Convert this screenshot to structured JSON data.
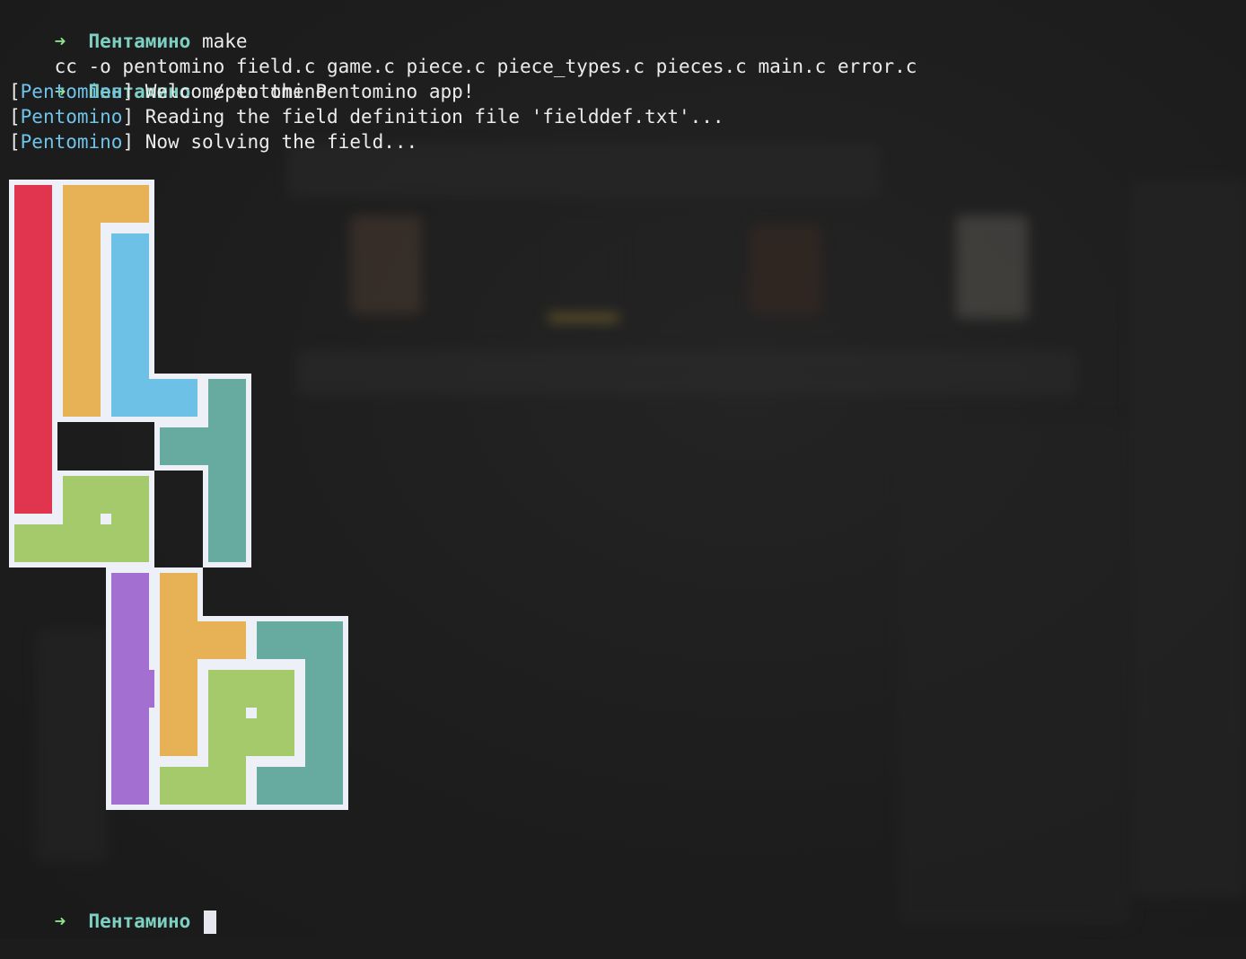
{
  "terminal": {
    "lines": [
      {
        "prompt_arrow": "➜",
        "dir": "Пентамино",
        "command": "make"
      },
      {
        "text": "cc -o pentomino field.c game.c piece.c piece_types.c pieces.c main.c error.c"
      },
      {
        "prompt_arrow": "➜",
        "dir": "Пентамино",
        "command": "./pentomino"
      },
      {
        "bracket_open": "[",
        "tag": "Pentomino",
        "bracket_close": "]",
        "message": " Welcome to the Pentomino app!"
      },
      {
        "bracket_open": "[",
        "tag": "Pentomino",
        "bracket_close": "]",
        "message": " Reading the field definition file 'fielddef.txt'..."
      },
      {
        "bracket_open": "[",
        "tag": "Pentomino",
        "bracket_close": "]",
        "message": " Now solving the field..."
      }
    ],
    "final_prompt": {
      "prompt_arrow": "➜",
      "dir": "Пентамино",
      "command": ""
    }
  },
  "colors": {
    "background": "#1c1c1c",
    "text": "#ececec",
    "prompt_arrow": "#8ee08e",
    "prompt_dir": "#7ed0c2",
    "tag": "#6fc3ea",
    "cell_border": "#eef0f8",
    "cursor": "#e6e6ef"
  },
  "solution": {
    "pieces": [
      {
        "id": "I",
        "color": "#e0344f",
        "cells": [
          [
            0,
            0
          ],
          [
            0,
            1
          ],
          [
            0,
            2
          ],
          [
            0,
            3
          ],
          [
            0,
            4
          ],
          [
            0,
            5
          ],
          [
            0,
            6
          ]
        ]
      },
      {
        "id": "L-yellow",
        "color": "#e6b255",
        "cells": [
          [
            1,
            0
          ],
          [
            2,
            0
          ],
          [
            1,
            1
          ],
          [
            1,
            2
          ],
          [
            1,
            3
          ],
          [
            1,
            4
          ]
        ]
      },
      {
        "id": "L-blue",
        "color": "#6dc0e6",
        "cells": [
          [
            2,
            1
          ],
          [
            2,
            2
          ],
          [
            2,
            3
          ],
          [
            2,
            4
          ],
          [
            3,
            4
          ]
        ]
      },
      {
        "id": "T-teal",
        "color": "#67aaa0",
        "cells": [
          [
            4,
            4
          ],
          [
            4,
            5
          ],
          [
            3,
            5
          ],
          [
            4,
            6
          ],
          [
            4,
            7
          ]
        ]
      },
      {
        "id": "P-green",
        "color": "#a5ca6c",
        "cells": [
          [
            1,
            6
          ],
          [
            2,
            6
          ],
          [
            0,
            7
          ],
          [
            1,
            7
          ],
          [
            2,
            7
          ]
        ]
      },
      {
        "id": "L-purple",
        "color": "#a370d2",
        "cells": [
          [
            2,
            8
          ],
          [
            2,
            9
          ],
          [
            2,
            10
          ],
          [
            3,
            10
          ],
          [
            2,
            11
          ],
          [
            2,
            12
          ]
        ]
      },
      {
        "id": "Y-yellow",
        "color": "#e6b255",
        "cells": [
          [
            3,
            8
          ],
          [
            3,
            9
          ],
          [
            4,
            9
          ],
          [
            3,
            10
          ],
          [
            3,
            11
          ]
        ]
      },
      {
        "id": "L-teal",
        "color": "#67aaa0",
        "cells": [
          [
            5,
            9
          ],
          [
            6,
            9
          ],
          [
            6,
            10
          ],
          [
            6,
            11
          ],
          [
            6,
            12
          ],
          [
            5,
            12
          ]
        ]
      },
      {
        "id": "S-green",
        "color": "#a5ca6c",
        "cells": [
          [
            4,
            11
          ],
          [
            5,
            11
          ],
          [
            4,
            10
          ],
          [
            5,
            10
          ],
          [
            3,
            12
          ],
          [
            4,
            12
          ]
        ]
      }
    ]
  }
}
